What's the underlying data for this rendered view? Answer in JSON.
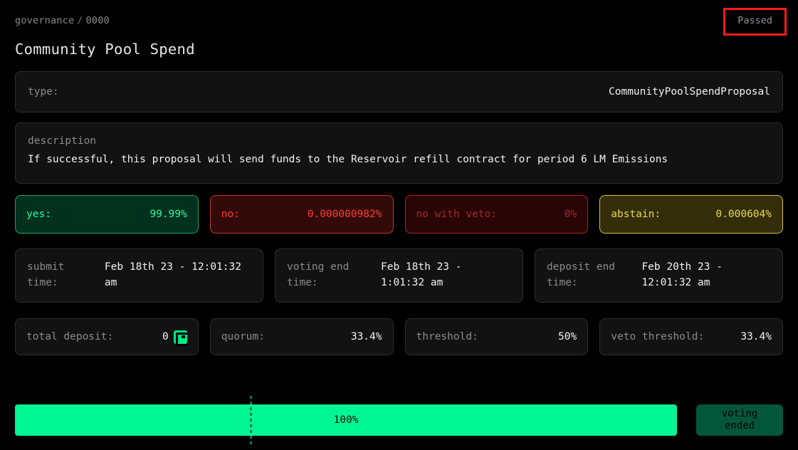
{
  "breadcrumb": {
    "section": "governance",
    "separator": "/",
    "id": "0000"
  },
  "page_title": "Community Pool Spend",
  "status_badge": {
    "label": "Passed",
    "border_color": "#ff1b1b",
    "text_color": "#8d9298"
  },
  "type_card": {
    "label": "type:",
    "value": "CommunityPoolSpendProposal"
  },
  "description_card": {
    "label": "description",
    "text": "If successful, this proposal will send funds to the Reservoir refill contract for period 6 LM Emissions"
  },
  "tally": [
    {
      "name": "yes",
      "label": "yes:",
      "value": "99.99%",
      "color": "#2bf79a"
    },
    {
      "name": "no",
      "label": "no:",
      "value": "0.000000982%",
      "color": "#ff3b30"
    },
    {
      "name": "no-with-veto",
      "label": "no with veto:",
      "value": "0%",
      "color": "#a32a2a"
    },
    {
      "name": "abstain",
      "label": "abstain:",
      "value": "0.000604%",
      "color": "#e9d94a"
    }
  ],
  "times": [
    {
      "name": "submit-time",
      "label": "submit time:",
      "value": "Feb 18th 23 - 12:01:32 am"
    },
    {
      "name": "voting-end-time",
      "label": "voting end time:",
      "value": "Feb 18th 23 - 1:01:32 am"
    },
    {
      "name": "deposit-end-time",
      "label": "deposit end time:",
      "value": "Feb 20th 23 - 12:01:32 am"
    }
  ],
  "stats": [
    {
      "name": "total-deposit",
      "label": "total deposit:",
      "value": "0",
      "icon": "token-icon"
    },
    {
      "name": "quorum",
      "label": "quorum:",
      "value": "33.4%",
      "icon": ""
    },
    {
      "name": "threshold",
      "label": "threshold:",
      "value": "50%",
      "icon": ""
    },
    {
      "name": "veto-threshold",
      "label": "veto threshold:",
      "value": "33.4%",
      "icon": ""
    }
  ],
  "progress": {
    "label": "100%",
    "percent": 100,
    "quorum_marker_percent": 35.5,
    "fill_color": "#00f593",
    "track_color": "#1b1b1b"
  },
  "vote_button": {
    "line1": "voting",
    "line2": "ended"
  }
}
